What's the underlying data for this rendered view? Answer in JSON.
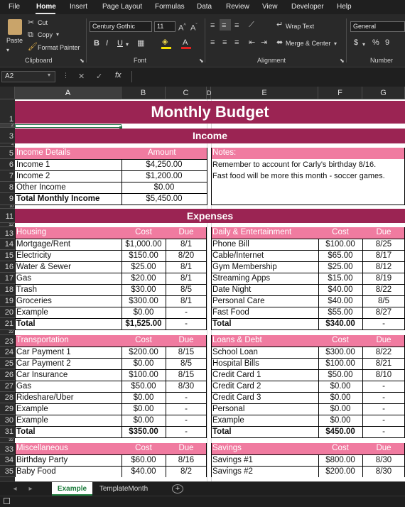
{
  "menu": {
    "tabs": [
      "File",
      "Home",
      "Insert",
      "Page Layout",
      "Formulas",
      "Data",
      "Review",
      "View",
      "Developer",
      "Help"
    ],
    "active": "Home"
  },
  "ribbon": {
    "paste": "Paste",
    "cut": "Cut",
    "copy": "Copy",
    "format_painter": "Format Painter",
    "clipboard": "Clipboard",
    "font_name": "Century Gothic",
    "font_size": "11",
    "font_group": "Font",
    "bold": "B",
    "italic": "I",
    "underline": "U",
    "wrap_text": "Wrap Text",
    "merge_center": "Merge & Center",
    "alignment": "Alignment",
    "number_format": "General",
    "number_group": "Number",
    "currency": "$",
    "percent": "%",
    "comma": "9"
  },
  "formula_bar": {
    "name_box": "A2",
    "fx": "fx",
    "cancel": "✕",
    "enter": "✓",
    "value": ""
  },
  "columns": [
    "A",
    "B",
    "C",
    "D",
    "E",
    "F",
    "G"
  ],
  "rows": [
    "1",
    "2",
    "3",
    "4",
    "5",
    "6",
    "7",
    "8",
    "9",
    "10",
    "11",
    "12",
    "13",
    "14",
    "15",
    "16",
    "17",
    "18",
    "19",
    "20",
    "21",
    "22",
    "23",
    "24",
    "25",
    "26",
    "27",
    "28",
    "29",
    "30",
    "31",
    "32",
    "33",
    "34",
    "35"
  ],
  "colors": {
    "banner": "#9b2453",
    "section_header": "#f07ba0"
  },
  "sheet": {
    "title": "Monthly Budget",
    "income_banner": "Income",
    "expenses_banner": "Expenses",
    "income": {
      "header": [
        "Income Details",
        "Amount"
      ],
      "rows": [
        [
          "Income 1",
          "$4,250.00"
        ],
        [
          "Income 2",
          "$1,200.00"
        ],
        [
          "Other Income",
          "$0.00"
        ]
      ],
      "total": [
        "Total Monthly Income",
        "$5,450.00"
      ]
    },
    "notes": {
      "header": "Notes:",
      "lines": [
        "Remember to account for Carly's birthday 8/16.",
        "Fast food will be more this month - soccer games."
      ]
    },
    "housing": {
      "header": [
        "Housing",
        "Cost",
        "Due"
      ],
      "rows": [
        [
          "Mortgage/Rent",
          "$1,000.00",
          "8/1"
        ],
        [
          "Electricity",
          "$150.00",
          "8/20"
        ],
        [
          "Water & Sewer",
          "$25.00",
          "8/1"
        ],
        [
          "Gas",
          "$20.00",
          "8/1"
        ],
        [
          "Trash",
          "$30.00",
          "8/5"
        ],
        [
          "Groceries",
          "$300.00",
          "8/1"
        ],
        [
          "Example",
          "$0.00",
          "-"
        ]
      ],
      "total": [
        "Total",
        "$1,525.00",
        "-"
      ]
    },
    "daily": {
      "header": [
        "Daily & Entertainment",
        "Cost",
        "Due"
      ],
      "rows": [
        [
          "Phone Bill",
          "$100.00",
          "8/25"
        ],
        [
          "Cable/Internet",
          "$65.00",
          "8/17"
        ],
        [
          "Gym Membership",
          "$25.00",
          "8/12"
        ],
        [
          "Streaming Apps",
          "$15.00",
          "8/19"
        ],
        [
          "Date Night",
          "$40.00",
          "8/22"
        ],
        [
          "Personal Care",
          "$40.00",
          "8/5"
        ],
        [
          "Fast Food",
          "$55.00",
          "8/27"
        ]
      ],
      "total": [
        "Total",
        "$340.00",
        "-"
      ]
    },
    "transportation": {
      "header": [
        "Transportation",
        "Cost",
        "Due"
      ],
      "rows": [
        [
          "Car Payment 1",
          "$200.00",
          "8/15"
        ],
        [
          "Car Payment 2",
          "$0.00",
          "8/5"
        ],
        [
          "Car Insurance",
          "$100.00",
          "8/15"
        ],
        [
          "Gas",
          "$50.00",
          "8/30"
        ],
        [
          "Rideshare/Uber",
          "$0.00",
          "-"
        ],
        [
          "Example",
          "$0.00",
          "-"
        ],
        [
          "Example",
          "$0.00",
          "-"
        ]
      ],
      "total": [
        "Total",
        "$350.00",
        "-"
      ]
    },
    "loans": {
      "header": [
        "Loans & Debt",
        "Cost",
        "Due"
      ],
      "rows": [
        [
          "School Loan",
          "$300.00",
          "8/22"
        ],
        [
          "Hospital Bills",
          "$100.00",
          "8/21"
        ],
        [
          "Credit Card 1",
          "$50.00",
          "8/10"
        ],
        [
          "Credit Card 2",
          "$0.00",
          "-"
        ],
        [
          "Credit Card 3",
          "$0.00",
          "-"
        ],
        [
          "Personal",
          "$0.00",
          "-"
        ],
        [
          "Example",
          "$0.00",
          "-"
        ]
      ],
      "total": [
        "Total",
        "$450.00",
        "-"
      ]
    },
    "misc": {
      "header": [
        "Miscellaneous",
        "Cost",
        "Due"
      ],
      "rows": [
        [
          "Birthday Party",
          "$60.00",
          "8/16"
        ],
        [
          "Baby Food",
          "$40.00",
          "8/2"
        ]
      ]
    },
    "savings": {
      "header": [
        "Savings",
        "Cost",
        "Due"
      ],
      "rows": [
        [
          "Savings #1",
          "$800.00",
          "8/30"
        ],
        [
          "Savings #2",
          "$200.00",
          "8/30"
        ]
      ]
    }
  },
  "tabs": {
    "sheets": [
      "Example",
      "TemplateMonth"
    ],
    "active": "Example",
    "add": "+"
  }
}
